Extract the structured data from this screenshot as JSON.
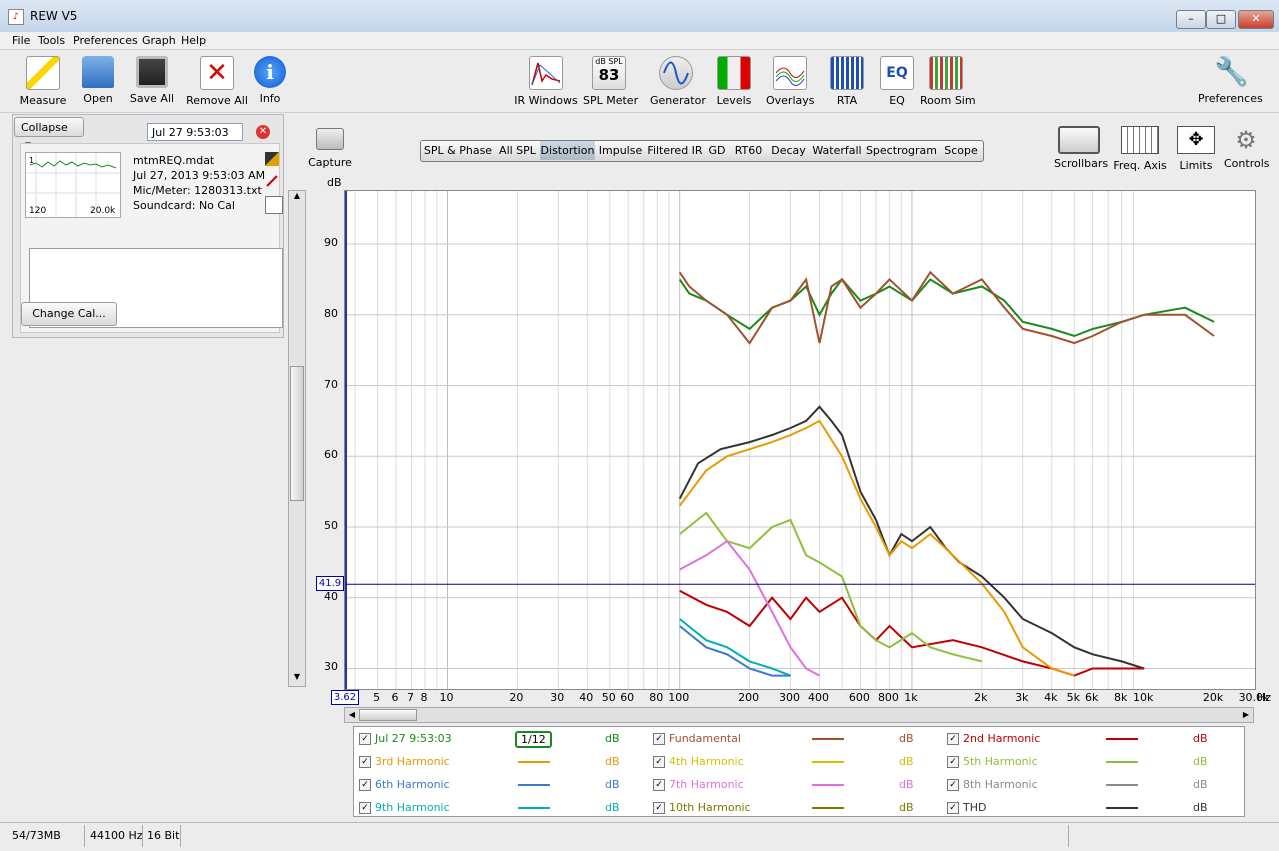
{
  "window": {
    "title": "REW V5"
  },
  "menu": [
    "File",
    "Tools",
    "Preferences",
    "Graph",
    "Help"
  ],
  "toolbar_left": [
    {
      "label": "Measure",
      "icon": "measure-icon"
    },
    {
      "label": "Open",
      "icon": "folder-icon"
    },
    {
      "label": "Save All",
      "icon": "save-icon"
    },
    {
      "label": "Remove All",
      "icon": "remove-icon"
    },
    {
      "label": "Info",
      "icon": "info-icon"
    }
  ],
  "toolbar_center": [
    {
      "label": "IR Windows",
      "icon": "ir-windows-icon"
    },
    {
      "label": "SPL Meter",
      "icon": "spl-meter-icon",
      "badge_top": "dB SPL",
      "badge_value": "83"
    },
    {
      "label": "Generator",
      "icon": "generator-icon"
    },
    {
      "label": "Levels",
      "icon": "levels-icon"
    },
    {
      "label": "Overlays",
      "icon": "overlays-icon"
    },
    {
      "label": "RTA",
      "icon": "rta-icon"
    },
    {
      "label": "EQ",
      "icon": "eq-icon"
    },
    {
      "label": "Room Sim",
      "icon": "room-sim-icon"
    }
  ],
  "toolbar_right": {
    "label": "Preferences",
    "icon": "wrench-icon"
  },
  "measurement_panel": {
    "collapse_label": "Collapse",
    "name_field": "Jul 27 9:53:03",
    "file": "mtmREQ.mdat",
    "date": "Jul 27, 2013 9:53:03 AM",
    "mic": "Mic/Meter: 1280313.txt",
    "soundcard": "Soundcard: No Cal",
    "thumb_low": "120",
    "thumb_high": "20.0k",
    "thumb_index": "1",
    "change_cal": "Change Cal..."
  },
  "capture": {
    "label": "Capture",
    "icon": "camera-icon"
  },
  "graph_tabs": [
    "SPL & Phase",
    "All SPL",
    "Distortion",
    "Impulse",
    "Filtered IR",
    "GD",
    "RT60",
    "Decay",
    "Waterfall",
    "Spectrogram",
    "Scope"
  ],
  "active_tab": "Distortion",
  "graph_controls": [
    {
      "label": "Scrollbars",
      "icon": "scrollbars-icon"
    },
    {
      "label": "Freq. Axis",
      "icon": "freq-axis-icon"
    },
    {
      "label": "Limits",
      "icon": "limits-icon"
    },
    {
      "label": "Controls",
      "icon": "gear-icon"
    }
  ],
  "chart_data": {
    "type": "line",
    "ylabel": "dB",
    "xlabel": "Hz",
    "x_scale": "log",
    "xlim": [
      3.62,
      30000
    ],
    "ylim": [
      27.1,
      97.5
    ],
    "y_ticks": [
      30,
      40,
      50,
      60,
      70,
      80,
      90
    ],
    "x_ticks": [
      {
        "v": 5,
        "l": "5"
      },
      {
        "v": 6,
        "l": "6"
      },
      {
        "v": 7,
        "l": "7"
      },
      {
        "v": 8,
        "l": "8"
      },
      {
        "v": 10,
        "l": "10"
      },
      {
        "v": 20,
        "l": "20"
      },
      {
        "v": 30,
        "l": "30"
      },
      {
        "v": 40,
        "l": "40"
      },
      {
        "v": 50,
        "l": "50"
      },
      {
        "v": 60,
        "l": "60"
      },
      {
        "v": 80,
        "l": "80"
      },
      {
        "v": 100,
        "l": "100"
      },
      {
        "v": 200,
        "l": "200"
      },
      {
        "v": 300,
        "l": "300"
      },
      {
        "v": 400,
        "l": "400"
      },
      {
        "v": 600,
        "l": "600"
      },
      {
        "v": 800,
        "l": "800"
      },
      {
        "v": 1000,
        "l": "1k"
      },
      {
        "v": 2000,
        "l": "2k"
      },
      {
        "v": 3000,
        "l": "3k"
      },
      {
        "v": 4000,
        "l": "4k"
      },
      {
        "v": 5000,
        "l": "5k"
      },
      {
        "v": 6000,
        "l": "6k"
      },
      {
        "v": 8000,
        "l": "8k"
      },
      {
        "v": 10000,
        "l": "10k"
      },
      {
        "v": 20000,
        "l": "20k"
      },
      {
        "v": 30000,
        "l": "30.0k"
      }
    ],
    "x_min_label": "3.62",
    "cursor_y": 41.9,
    "cursor_label": "41.9",
    "grid": true,
    "series": [
      {
        "name": "Jul 27 9:53:03",
        "color": "#1a8a1a",
        "points": [
          [
            100,
            85
          ],
          [
            110,
            83
          ],
          [
            130,
            82
          ],
          [
            160,
            80
          ],
          [
            200,
            78
          ],
          [
            250,
            81
          ],
          [
            300,
            82
          ],
          [
            350,
            84
          ],
          [
            400,
            80
          ],
          [
            450,
            83
          ],
          [
            500,
            85
          ],
          [
            600,
            82
          ],
          [
            700,
            83
          ],
          [
            800,
            84
          ],
          [
            1000,
            82
          ],
          [
            1200,
            85
          ],
          [
            1500,
            83
          ],
          [
            2000,
            84
          ],
          [
            2500,
            82
          ],
          [
            3000,
            79
          ],
          [
            4000,
            78
          ],
          [
            5000,
            77
          ],
          [
            6000,
            78
          ],
          [
            8000,
            79
          ],
          [
            10000,
            80
          ],
          [
            15000,
            81
          ],
          [
            20000,
            79
          ]
        ]
      },
      {
        "name": "Fundamental",
        "color": "#a0522d",
        "points": [
          [
            100,
            86
          ],
          [
            110,
            84
          ],
          [
            130,
            82
          ],
          [
            160,
            80
          ],
          [
            200,
            76
          ],
          [
            250,
            81
          ],
          [
            300,
            82
          ],
          [
            350,
            85
          ],
          [
            400,
            76
          ],
          [
            450,
            84
          ],
          [
            500,
            85
          ],
          [
            600,
            81
          ],
          [
            700,
            83
          ],
          [
            800,
            85
          ],
          [
            1000,
            82
          ],
          [
            1200,
            86
          ],
          [
            1500,
            83
          ],
          [
            2000,
            85
          ],
          [
            2500,
            81
          ],
          [
            3000,
            78
          ],
          [
            4000,
            77
          ],
          [
            5000,
            76
          ],
          [
            6000,
            77
          ],
          [
            8000,
            79
          ],
          [
            10000,
            80
          ],
          [
            15000,
            80
          ],
          [
            20000,
            77
          ]
        ]
      },
      {
        "name": "THD",
        "color": "#333333",
        "points": [
          [
            100,
            54
          ],
          [
            120,
            59
          ],
          [
            150,
            61
          ],
          [
            200,
            62
          ],
          [
            250,
            63
          ],
          [
            300,
            64
          ],
          [
            350,
            65
          ],
          [
            400,
            67
          ],
          [
            450,
            65
          ],
          [
            500,
            63
          ],
          [
            600,
            55
          ],
          [
            700,
            51
          ],
          [
            800,
            46
          ],
          [
            900,
            49
          ],
          [
            1000,
            48
          ],
          [
            1200,
            50
          ],
          [
            1400,
            47
          ],
          [
            1600,
            45
          ],
          [
            2000,
            43
          ],
          [
            2500,
            40
          ],
          [
            3000,
            37
          ],
          [
            4000,
            35
          ],
          [
            5000,
            33
          ],
          [
            6000,
            32
          ],
          [
            8000,
            31
          ],
          [
            10000,
            30
          ]
        ]
      },
      {
        "name": "2nd Harmonic",
        "color": "#c00000",
        "points": [
          [
            100,
            41
          ],
          [
            130,
            39
          ],
          [
            160,
            38
          ],
          [
            200,
            36
          ],
          [
            250,
            40
          ],
          [
            300,
            37
          ],
          [
            350,
            40
          ],
          [
            400,
            38
          ],
          [
            500,
            40
          ],
          [
            600,
            36
          ],
          [
            700,
            34
          ],
          [
            800,
            36
          ],
          [
            1000,
            33
          ],
          [
            1500,
            34
          ],
          [
            2000,
            33
          ],
          [
            3000,
            31
          ],
          [
            4000,
            30
          ],
          [
            5000,
            29
          ],
          [
            6000,
            30
          ],
          [
            8000,
            30
          ],
          [
            10000,
            30
          ]
        ]
      },
      {
        "name": "3rd Harmonic",
        "color": "#e89a00",
        "points": [
          [
            100,
            53
          ],
          [
            130,
            58
          ],
          [
            160,
            60
          ],
          [
            200,
            61
          ],
          [
            250,
            62
          ],
          [
            300,
            63
          ],
          [
            350,
            64
          ],
          [
            400,
            65
          ],
          [
            500,
            60
          ],
          [
            600,
            54
          ],
          [
            700,
            50
          ],
          [
            800,
            46
          ],
          [
            900,
            48
          ],
          [
            1000,
            47
          ],
          [
            1200,
            49
          ],
          [
            1500,
            46
          ],
          [
            2000,
            42
          ],
          [
            2500,
            38
          ],
          [
            3000,
            33
          ],
          [
            4000,
            30
          ],
          [
            5000,
            29
          ]
        ]
      },
      {
        "name": "5th Harmonic",
        "color": "#8fc03a",
        "points": [
          [
            100,
            49
          ],
          [
            130,
            52
          ],
          [
            160,
            48
          ],
          [
            200,
            47
          ],
          [
            250,
            50
          ],
          [
            300,
            51
          ],
          [
            350,
            46
          ],
          [
            400,
            45
          ],
          [
            500,
            43
          ],
          [
            600,
            36
          ],
          [
            700,
            34
          ],
          [
            800,
            33
          ],
          [
            1000,
            35
          ],
          [
            1200,
            33
          ],
          [
            1500,
            32
          ],
          [
            2000,
            31
          ]
        ]
      },
      {
        "name": "7th Harmonic",
        "color": "#e070e0",
        "points": [
          [
            100,
            44
          ],
          [
            130,
            46
          ],
          [
            160,
            48
          ],
          [
            200,
            44
          ],
          [
            250,
            38
          ],
          [
            300,
            33
          ],
          [
            350,
            30
          ],
          [
            400,
            29
          ]
        ]
      },
      {
        "name": "9th Harmonic",
        "color": "#00b0b0",
        "points": [
          [
            100,
            37
          ],
          [
            130,
            34
          ],
          [
            160,
            33
          ],
          [
            200,
            31
          ],
          [
            250,
            30
          ],
          [
            300,
            29
          ]
        ]
      },
      {
        "name": "6th Harmonic",
        "color": "#3a7ad0",
        "points": [
          [
            100,
            36
          ],
          [
            130,
            33
          ],
          [
            160,
            32
          ],
          [
            200,
            30
          ],
          [
            250,
            29
          ],
          [
            300,
            29
          ]
        ]
      }
    ]
  },
  "legend": [
    [
      {
        "name": "Jul 27 9:53:03",
        "color": "#1a8a1a",
        "unit": "dB",
        "smoothing": "1/12"
      },
      {
        "name": "3rd Harmonic",
        "color": "#e89a00",
        "unit": "dB"
      },
      {
        "name": "6th Harmonic",
        "color": "#3a7ad0",
        "unit": "dB"
      },
      {
        "name": "9th Harmonic",
        "color": "#00b0b0",
        "unit": "dB"
      }
    ],
    [
      {
        "name": "Fundamental",
        "color": "#a0522d",
        "unit": "dB"
      },
      {
        "name": "4th Harmonic",
        "color": "#d4c000",
        "unit": "dB"
      },
      {
        "name": "7th Harmonic",
        "color": "#e070e0",
        "unit": "dB"
      },
      {
        "name": "10th Harmonic",
        "color": "#7a7a00",
        "unit": "dB"
      }
    ],
    [
      {
        "name": "2nd Harmonic",
        "color": "#c00000",
        "unit": "dB"
      },
      {
        "name": "5th Harmonic",
        "color": "#8fc03a",
        "unit": "dB"
      },
      {
        "name": "8th Harmonic",
        "color": "#8a8a8a",
        "unit": "dB"
      },
      {
        "name": "THD",
        "color": "#333333",
        "unit": "dB"
      }
    ]
  ],
  "status": {
    "memory": "54/73MB",
    "rate": "44100 Hz",
    "bits": "16 Bit"
  }
}
